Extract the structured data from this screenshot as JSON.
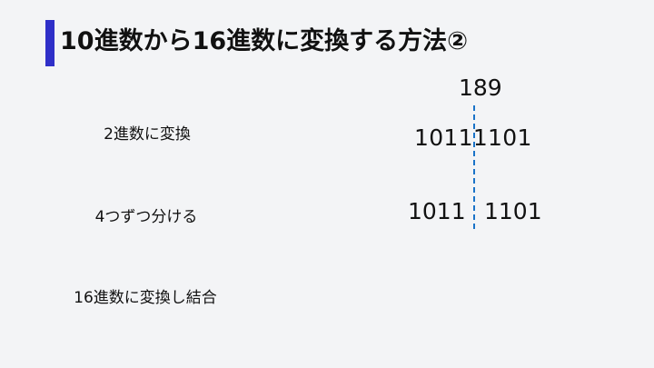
{
  "slide": {
    "title": "10進数から16進数に変換する方法②",
    "accent_color": "#2f2fc8",
    "divider_color": "#1a73c8",
    "steps": [
      "2進数に変換",
      "4つずつ分ける",
      "16進数に変換し結合"
    ],
    "decimal": "189",
    "binary": "10111101",
    "binary_high": "1011",
    "binary_low": "1101"
  }
}
